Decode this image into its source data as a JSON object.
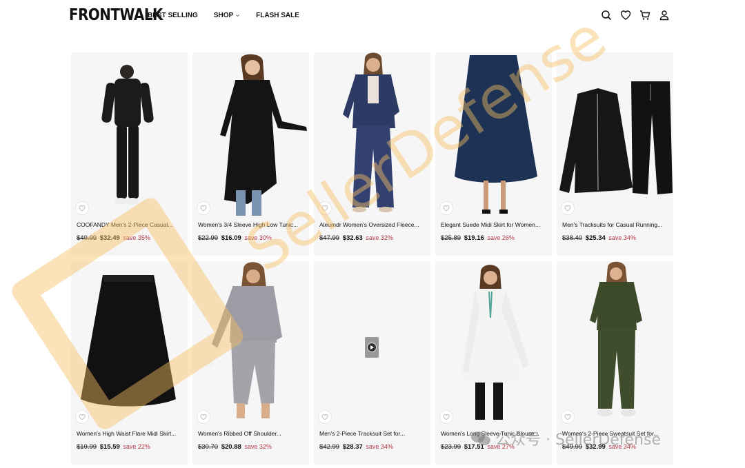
{
  "brand": {
    "logo_text": "FRONTWALK"
  },
  "nav": {
    "items": [
      {
        "label": "BEST SELLING"
      },
      {
        "label": "SHOP"
      },
      {
        "label": "FLASH SALE"
      }
    ]
  },
  "header_icons": [
    "search-icon",
    "heart-icon",
    "cart-icon",
    "user-icon"
  ],
  "colors": {
    "save_text": "#b3384a",
    "card_bg": "#f6f6f6",
    "watermark": "#f7be62"
  },
  "products": [
    {
      "title": "COOFANDY Men's 2-Piece Casual...",
      "old_price": "$49.99",
      "price": "$32.49",
      "save": "save 35%"
    },
    {
      "title": "Women's 3/4 Sleeve High Low Tunic...",
      "old_price": "$22.99",
      "price": "$16.09",
      "save": "save 30%"
    },
    {
      "title": "Aleumdr Women's Oversized Fleece...",
      "old_price": "$47.99",
      "price": "$32.63",
      "save": "save 32%"
    },
    {
      "title": "Elegant Suede Midi Skirt for Women...",
      "old_price": "$25.89",
      "price": "$19.16",
      "save": "save 26%"
    },
    {
      "title": "Men's Tracksuits for Casual Running...",
      "old_price": "$38.40",
      "price": "$25.34",
      "save": "save 34%"
    },
    {
      "title": "Women's High Waist Flare Midi Skirt...",
      "old_price": "$19.99",
      "price": "$15.59",
      "save": "save 22%"
    },
    {
      "title": "Women's Ribbed Off Shoulder...",
      "old_price": "$30.70",
      "price": "$20.88",
      "save": "save 32%"
    },
    {
      "title": "Men's 2-Piece Tracksuit Set for...",
      "old_price": "$42.99",
      "price": "$28.37",
      "save": "save 34%"
    },
    {
      "title": "Women's Long Sleeve Tunic Blouse...",
      "old_price": "$23.99",
      "price": "$17.51",
      "save": "save 27%"
    },
    {
      "title": "Women's 2-Piece Sweatsuit Set for...",
      "old_price": "$49.99",
      "price": "$32.99",
      "save": "save 34%"
    }
  ],
  "watermark": {
    "text": "SellerDefense",
    "bottom_text": "公众号 · SellerDefense"
  }
}
